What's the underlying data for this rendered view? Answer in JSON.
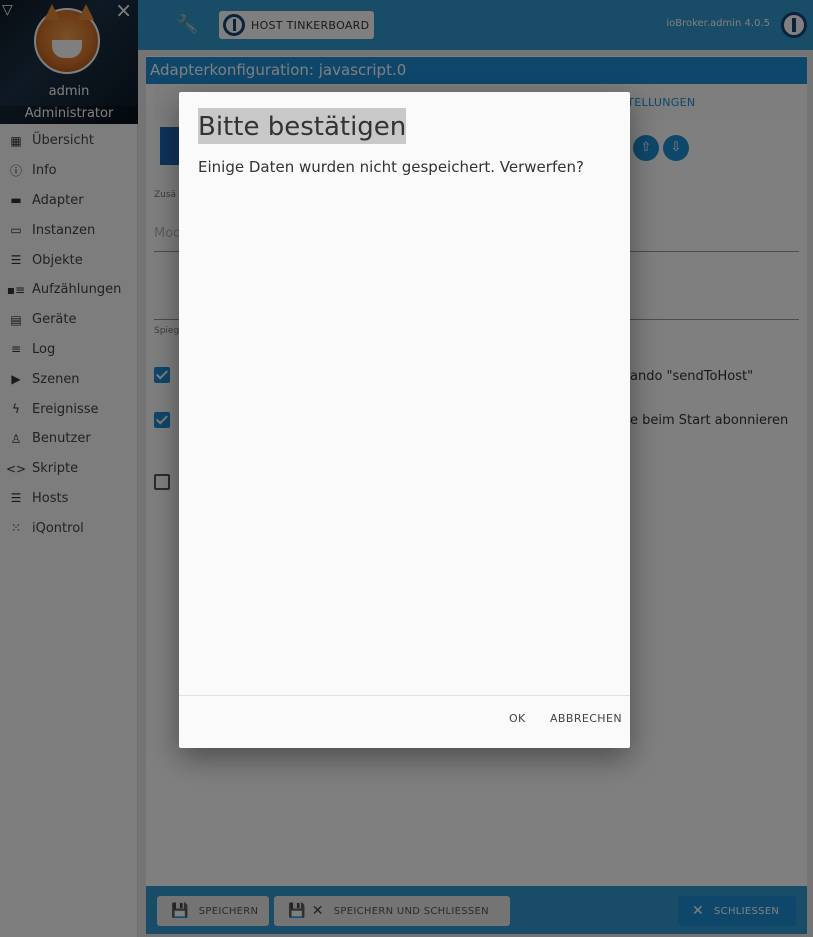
{
  "sidebar": {
    "username": "admin",
    "role": "Administrator",
    "items": [
      {
        "label": "Übersicht",
        "icon": "grid-icon"
      },
      {
        "label": "Info",
        "icon": "info-icon"
      },
      {
        "label": "Adapter",
        "icon": "store-icon"
      },
      {
        "label": "Instanzen",
        "icon": "instances-icon"
      },
      {
        "label": "Objekte",
        "icon": "list-icon"
      },
      {
        "label": "Aufzählungen",
        "icon": "enum-icon"
      },
      {
        "label": "Geräte",
        "icon": "device-icon"
      },
      {
        "label": "Log",
        "icon": "log-icon"
      },
      {
        "label": "Szenen",
        "icon": "scene-icon"
      },
      {
        "label": "Ereignisse",
        "icon": "bolt-icon"
      },
      {
        "label": "Benutzer",
        "icon": "user-icon"
      },
      {
        "label": "Skripte",
        "icon": "code-icon"
      },
      {
        "label": "Hosts",
        "icon": "hosts-icon"
      },
      {
        "label": "iQontrol",
        "icon": "dots-icon"
      }
    ]
  },
  "topbar": {
    "host_label": "HOST TINKERBOARD",
    "version": "ioBroker.admin 4.0.5"
  },
  "config": {
    "title": "Adapterkonfiguration: javascript.0",
    "tab_partial": "STELLUNGEN",
    "label_zusa": "Zusä",
    "ghost_mod": "Mod",
    "label_spieg": "Spieg",
    "text_sendtohost": "ando \"sendToHost\"",
    "text_abonnieren": "e beim Start abonnieren"
  },
  "bottombar": {
    "save": "SPEICHERN",
    "save_close": "SPEICHERN UND SCHLIESSEN",
    "close": "SCHLIESSEN"
  },
  "dialog": {
    "title": "Bitte bestätigen",
    "message": "Einige Daten wurden nicht gespeichert. Verwerfen?",
    "ok": "OK",
    "cancel": "ABBRECHEN"
  },
  "colors": {
    "accent": "#3399cc",
    "titlebar": "#1f8fd6"
  }
}
